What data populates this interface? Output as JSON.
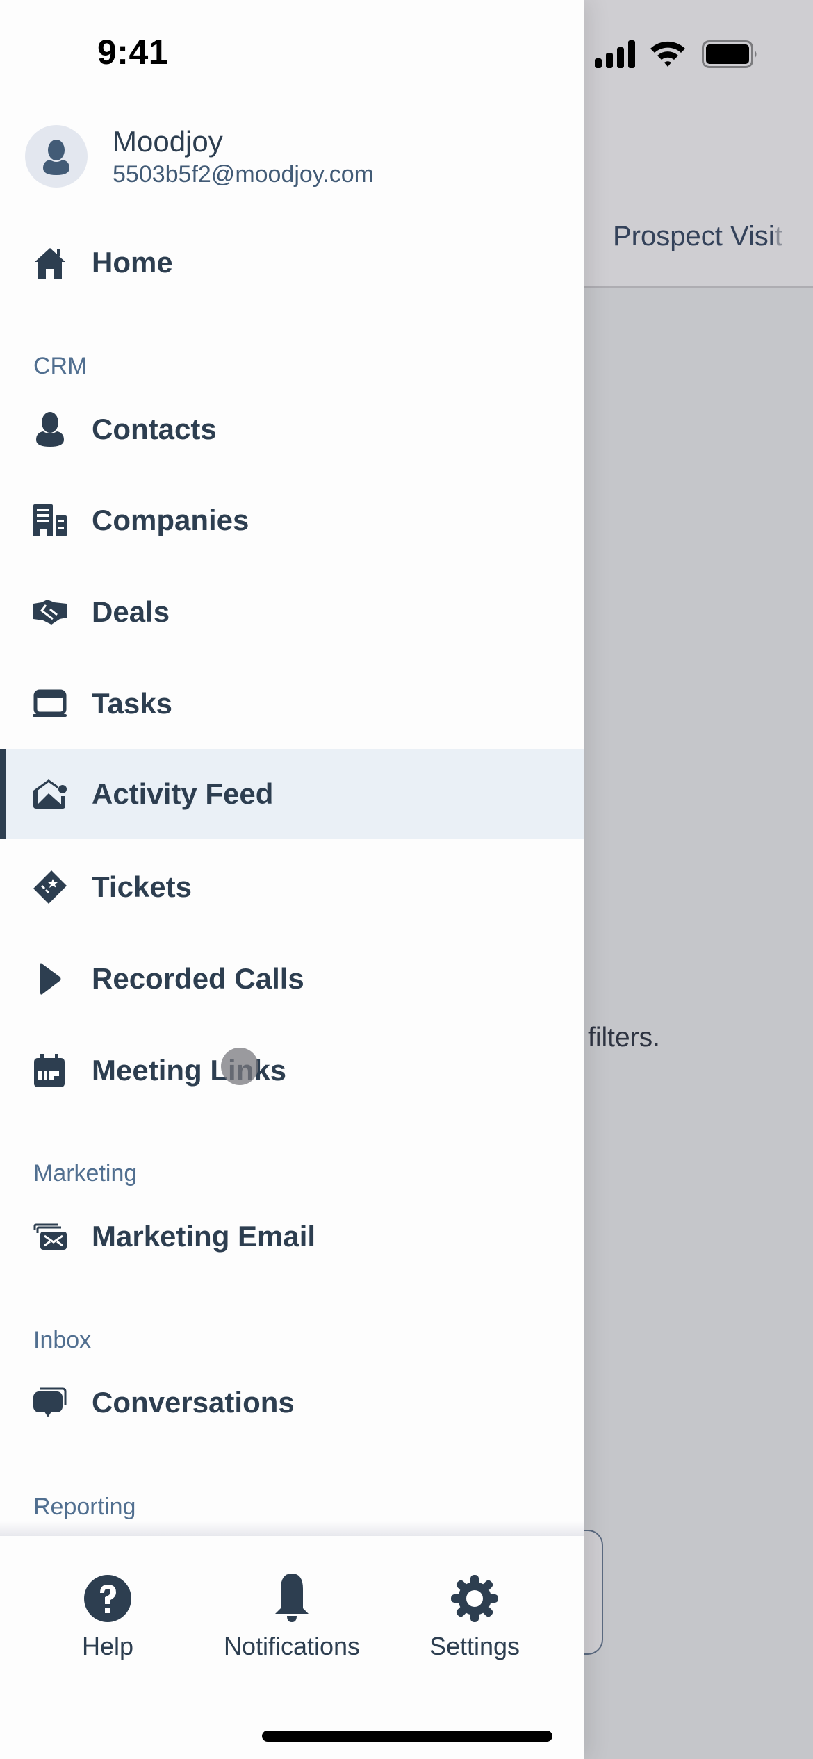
{
  "status_bar": {
    "time": "9:41"
  },
  "background_screen": {
    "tab_label_visible": "Prospect Visi",
    "tab_label_fading": "t",
    "empty_message_fragment": "filters."
  },
  "drawer": {
    "profile": {
      "name": "Moodjoy",
      "email": "5503b5f2@moodjoy.com",
      "avatar_icon": "user-silhouette-icon"
    },
    "home": {
      "label": "Home",
      "icon": "home-icon"
    },
    "sections": [
      {
        "title": "CRM",
        "items": [
          {
            "label": "Contacts",
            "icon": "contact-icon",
            "active": false
          },
          {
            "label": "Companies",
            "icon": "building-icon",
            "active": false
          },
          {
            "label": "Deals",
            "icon": "handshake-icon",
            "active": false
          },
          {
            "label": "Tasks",
            "icon": "task-icon",
            "active": false
          },
          {
            "label": "Activity Feed",
            "icon": "activity-feed-icon",
            "active": true
          },
          {
            "label": "Tickets",
            "icon": "ticket-icon",
            "active": false
          },
          {
            "label": "Recorded Calls",
            "icon": "play-icon",
            "active": false
          },
          {
            "label": "Meeting Links",
            "icon": "calendar-icon",
            "active": false
          }
        ]
      },
      {
        "title": "Marketing",
        "items": [
          {
            "label": "Marketing Email",
            "icon": "marketing-email-icon",
            "active": false
          }
        ]
      },
      {
        "title": "Inbox",
        "items": [
          {
            "label": "Conversations",
            "icon": "conversations-icon",
            "active": false
          }
        ]
      },
      {
        "title": "Reporting",
        "items": []
      }
    ],
    "bottom_bar": [
      {
        "label": "Help",
        "icon": "help-icon"
      },
      {
        "label": "Notifications",
        "icon": "bell-icon"
      },
      {
        "label": "Settings",
        "icon": "gear-icon"
      }
    ]
  },
  "colors": {
    "text_primary": "#2d3e50",
    "section_header": "#516f90",
    "active_bg": "#eaf0f6",
    "active_bar": "#2d3e50",
    "overlay_bg": "#c5c6ca"
  }
}
